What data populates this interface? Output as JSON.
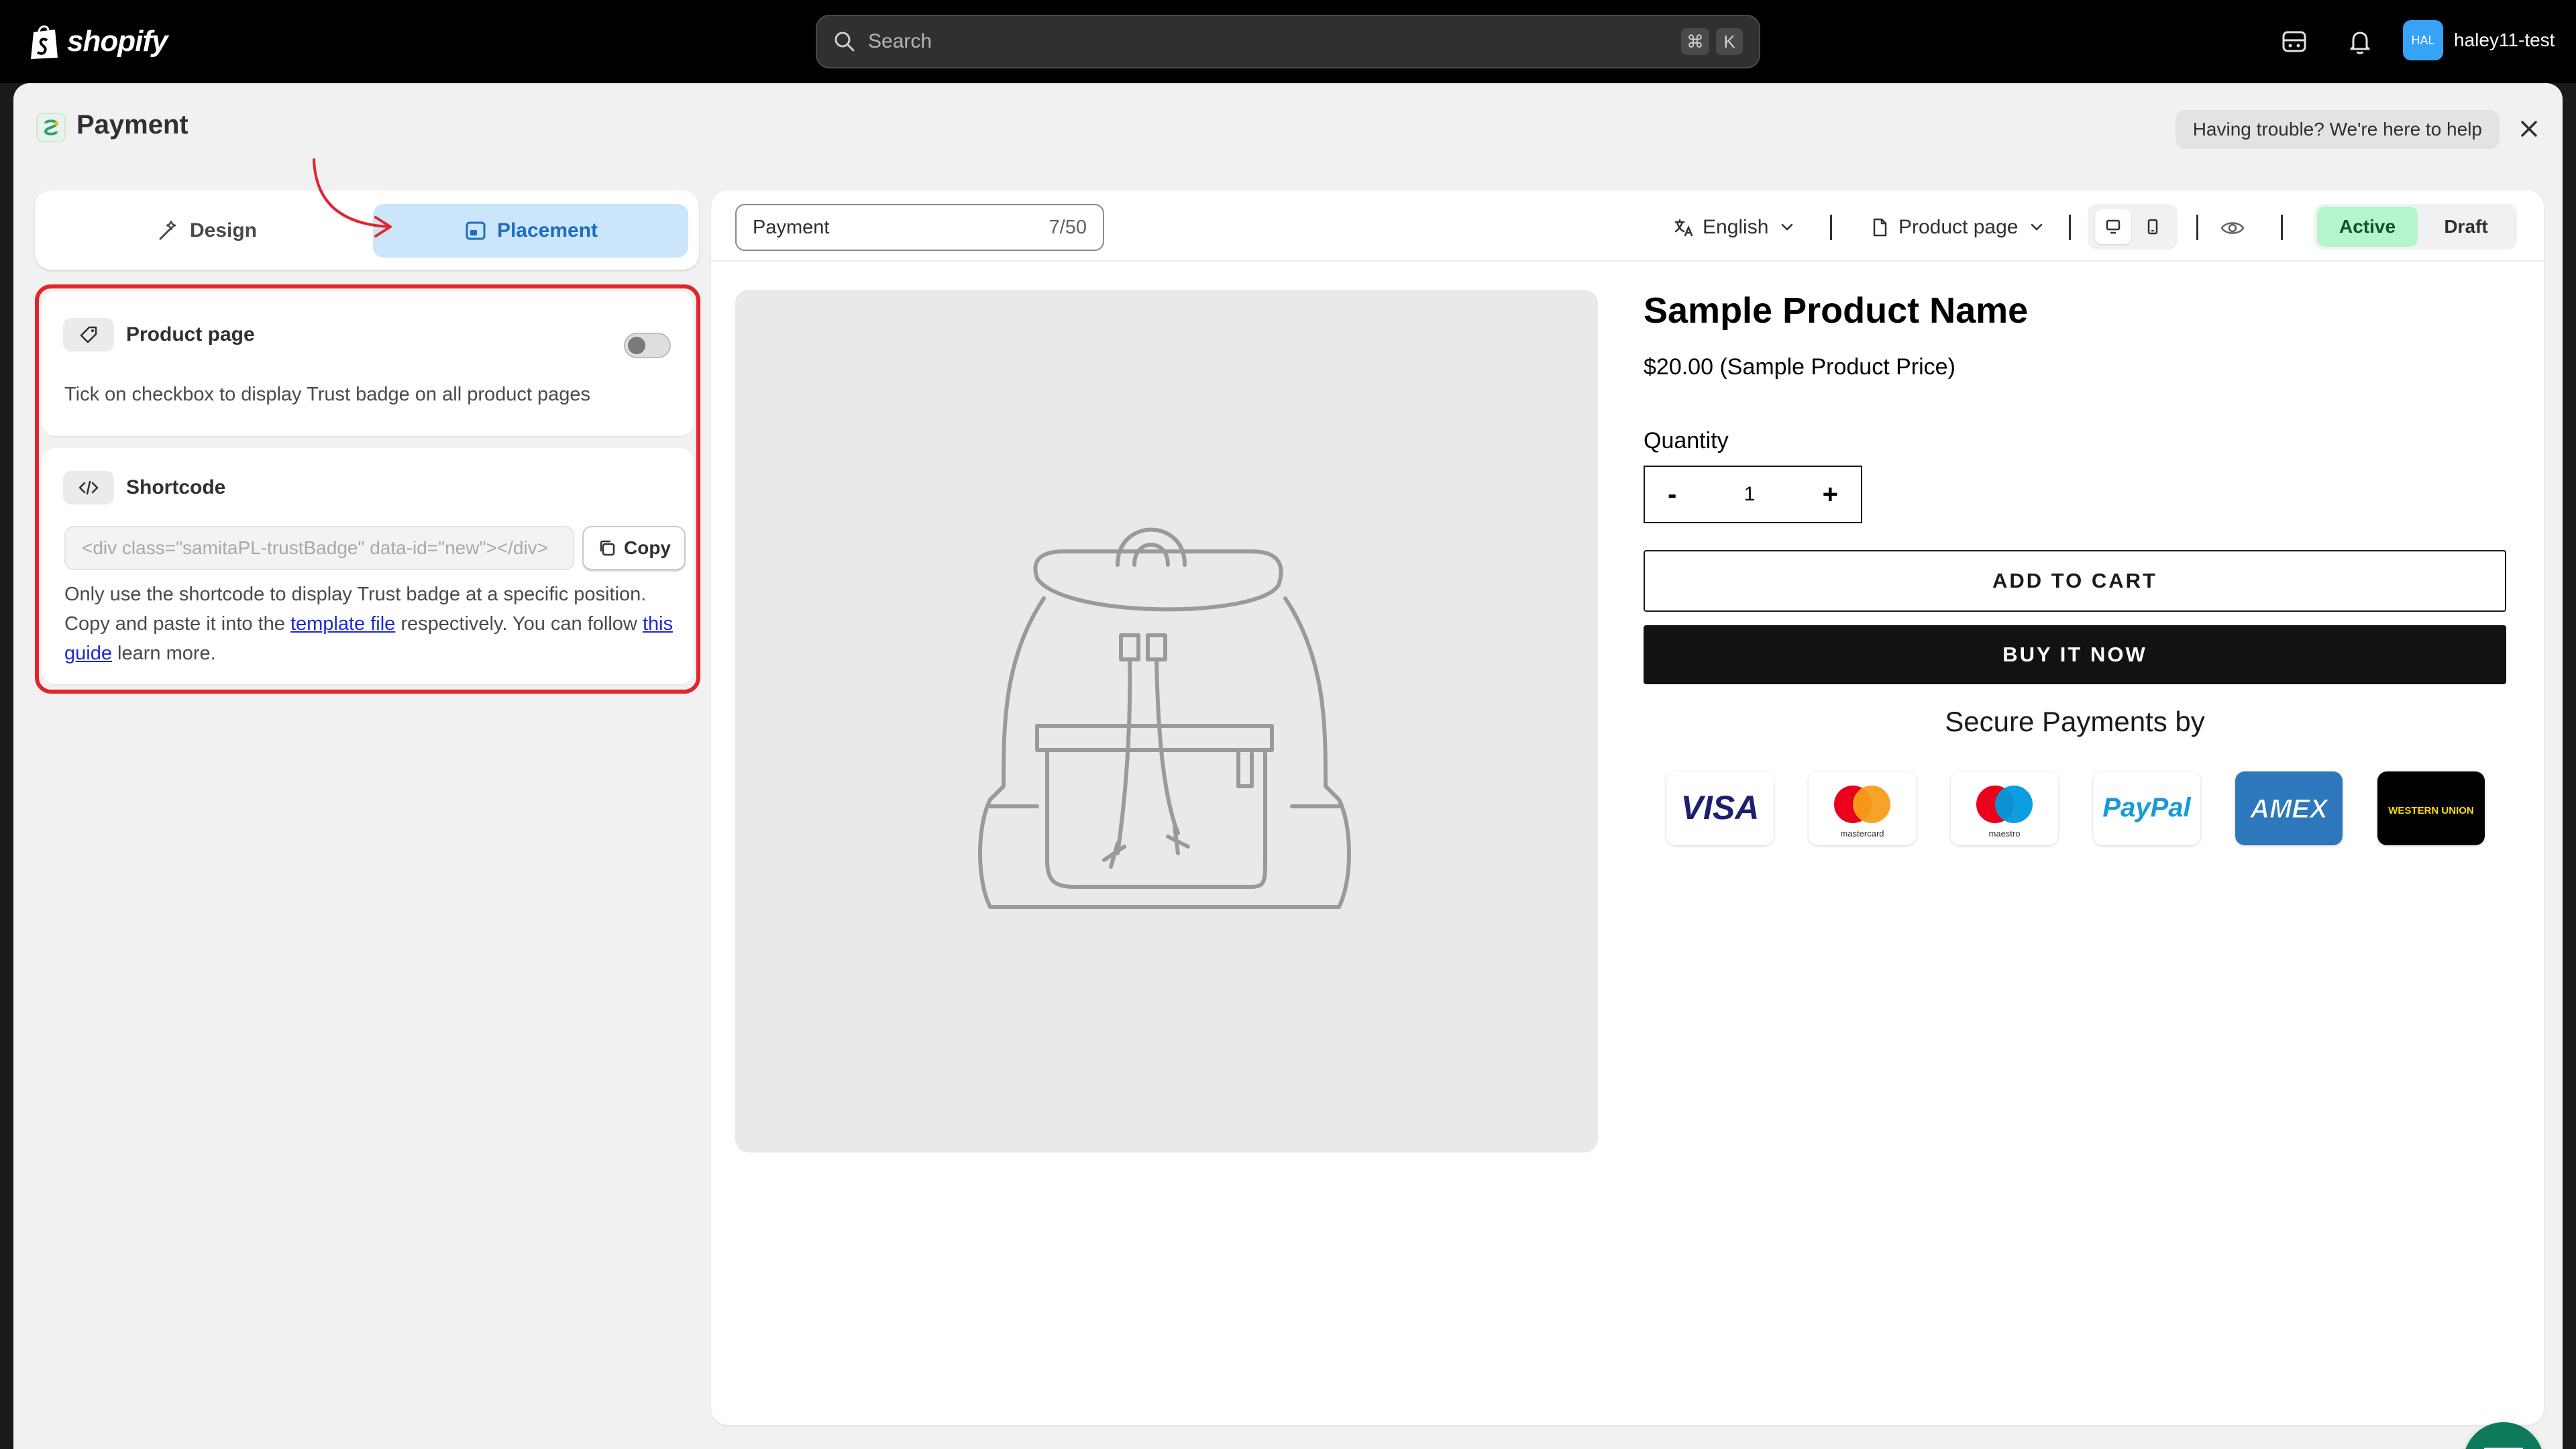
{
  "topbar": {
    "logo_text": "shopify",
    "search_placeholder": "Search",
    "shortcut_keys": [
      "⌘",
      "K"
    ],
    "user_initials": "HAL",
    "user_name": "haley11-test"
  },
  "app": {
    "title": "Payment",
    "help_label": "Having trouble? We're here to help"
  },
  "tabs": {
    "design": "Design",
    "placement": "Placement",
    "active": "placement"
  },
  "placement": {
    "product_page": {
      "title": "Product page",
      "description": "Tick on checkbox to display Trust badge on all product pages",
      "enabled": false
    },
    "shortcode": {
      "title": "Shortcode",
      "code": "<div class=\"samitaPL-trustBadge\" data-id=\"new\"></div>",
      "copy_label": "Copy",
      "desc_part1": "Only use the shortcode to display Trust badge at a specific position. Copy and paste it into the ",
      "link1": "template file",
      "desc_part2": " respectively. You can follow ",
      "link2": "this guide",
      "desc_part3": " learn more."
    }
  },
  "toolbar": {
    "name_value": "Payment",
    "name_count": "7/50",
    "language": "English",
    "page": "Product page",
    "status_active": "Active",
    "status_draft": "Draft"
  },
  "product": {
    "name": "Sample Product Name",
    "price": "$20.00 (Sample Product Price)",
    "quantity_label": "Quantity",
    "quantity": "1",
    "minus": "-",
    "plus": "+",
    "add_to_cart": "ADD TO CART",
    "buy_now": "BUY IT NOW",
    "secure_title": "Secure Payments by",
    "badges": [
      "VISA",
      "mastercard",
      "maestro",
      "PayPal",
      "AMEX",
      "WESTERN UNION"
    ]
  },
  "colors": {
    "accent_blue": "#1e6dc1",
    "highlight_red": "#e3242b",
    "active_green": "#b4f5cc",
    "chat_green": "#0e7a5b"
  }
}
